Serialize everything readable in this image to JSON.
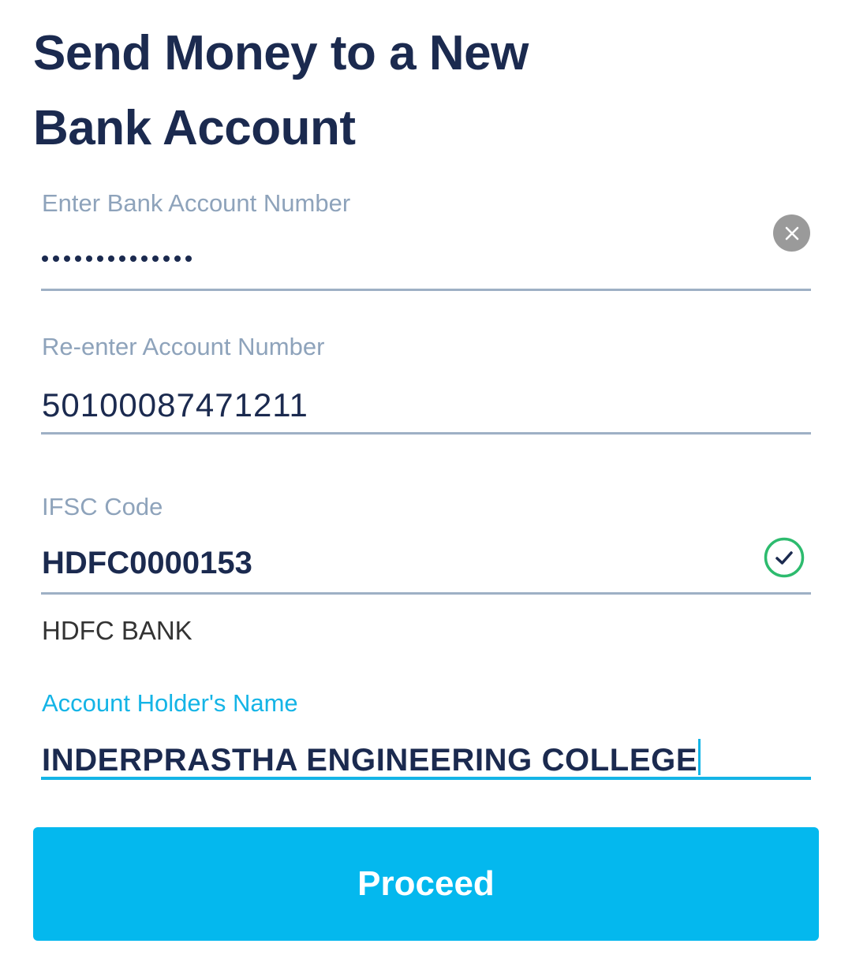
{
  "page": {
    "title_line1": "Send Money to a New",
    "title_line2": "Bank Account"
  },
  "fields": {
    "account_number": {
      "label": "Enter Bank Account Number",
      "masked_length": 14,
      "clear_icon": "close-icon"
    },
    "reenter_account": {
      "label": "Re-enter Account Number",
      "value": "50100087471211"
    },
    "ifsc": {
      "label": "IFSC Code",
      "value": "HDFC0000153",
      "bank_name": "HDFC BANK",
      "status_icon": "check-circle-icon"
    },
    "holder_name": {
      "label": "Account Holder's Name",
      "value": "INDERPRASTHA ENGINEERING COLLEGE"
    }
  },
  "actions": {
    "proceed_label": "Proceed"
  },
  "colors": {
    "title": "#1b2a4f",
    "label": "#8ea3bb",
    "accent": "#14b4e6",
    "button": "#04b8ee",
    "success": "#2dbb6e"
  }
}
